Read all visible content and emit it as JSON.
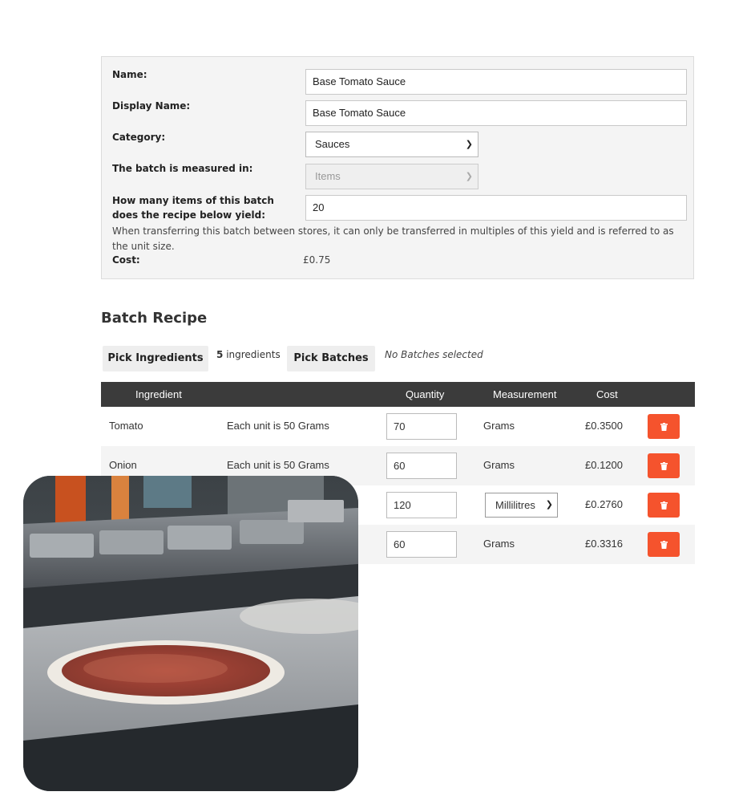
{
  "form": {
    "name_label": "Name:",
    "name_value": "Base Tomato Sauce",
    "display_name_label": "Display Name:",
    "display_name_value": "Base Tomato Sauce",
    "category_label": "Category:",
    "category_value": "Sauces",
    "measured_label": "The batch is measured in:",
    "measured_value": "Items",
    "yield_label": "How many items of this batch does the recipe below yield:",
    "yield_value": "20",
    "note": "When transferring this batch between stores, it can only be transferred in multiples of this yield and is referred to as the unit size.",
    "cost_label": "Cost:",
    "cost_value": "£0.75"
  },
  "recipe": {
    "title": "Batch Recipe",
    "pick_ingredients": "Pick Ingredients",
    "ingredient_count": "5",
    "ingredient_count_suffix": "ingredients",
    "pick_batches": "Pick Batches",
    "no_batches": "No Batches selected",
    "headers": {
      "ingredient": "Ingredient",
      "quantity": "Quantity",
      "measurement": "Measurement",
      "cost": "Cost"
    },
    "rows": [
      {
        "ingredient": "Tomato",
        "unit": "Each unit is 50 Grams",
        "quantity": "70",
        "measurement": "Grams",
        "cost": "£0.3500"
      },
      {
        "ingredient": "Onion",
        "unit": "Each unit is 50 Grams",
        "quantity": "60",
        "measurement": "Grams",
        "cost": "£0.1200"
      },
      {
        "quantity": "120",
        "measurement": "Millilitres",
        "cost": "£0.2760"
      },
      {
        "quantity": "60",
        "measurement": "Grams",
        "cost": "£0.3316"
      }
    ]
  },
  "colors": {
    "delete_button": "#f5532d",
    "table_header": "#3b3b3b",
    "panel_background": "#f4f4f4"
  },
  "icons": {
    "delete": "trash-icon",
    "dropdown": "chevron-down-icon"
  }
}
